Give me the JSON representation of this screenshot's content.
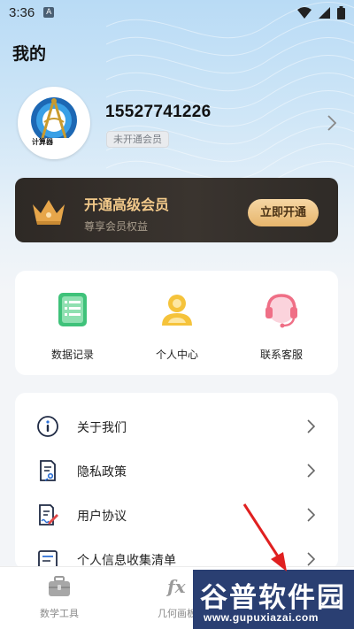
{
  "status_bar": {
    "time": "3:36",
    "notification_badge": "A",
    "icons": [
      "wifi-icon",
      "signal-icon",
      "battery-icon"
    ]
  },
  "header": {
    "title": "我的"
  },
  "profile": {
    "avatar_caption": "计算器",
    "phone": "15527741226",
    "membership_status": "未开通会员"
  },
  "vip_banner": {
    "title": "开通高级会员",
    "subtitle": "尊享会员权益",
    "button_label": "立即开通"
  },
  "quick_actions": [
    {
      "label": "数据记录",
      "icon": "data-record-icon",
      "color": "#3fc27a"
    },
    {
      "label": "个人中心",
      "icon": "person-center-icon",
      "color": "#f5c33b"
    },
    {
      "label": "联系客服",
      "icon": "customer-service-icon",
      "color": "#ef6f86"
    }
  ],
  "menu": [
    {
      "label": "关于我们",
      "icon": "info-icon"
    },
    {
      "label": "隐私政策",
      "icon": "privacy-policy-icon"
    },
    {
      "label": "用户协议",
      "icon": "user-agreement-icon"
    },
    {
      "label": "个人信息收集清单",
      "icon": "info-list-icon"
    }
  ],
  "tab_bar": {
    "tabs": [
      {
        "label": "数学工具",
        "icon": "toolbox-icon"
      },
      {
        "label": "几何画板",
        "icon": "fx-icon"
      }
    ]
  },
  "watermark": {
    "text": "谷普软件园",
    "url": "www.gupuxiazai.com"
  },
  "colors": {
    "vip_gold": "#f2c98a",
    "vip_dark": "#2e2925",
    "accent_arrow": "#e02020"
  }
}
